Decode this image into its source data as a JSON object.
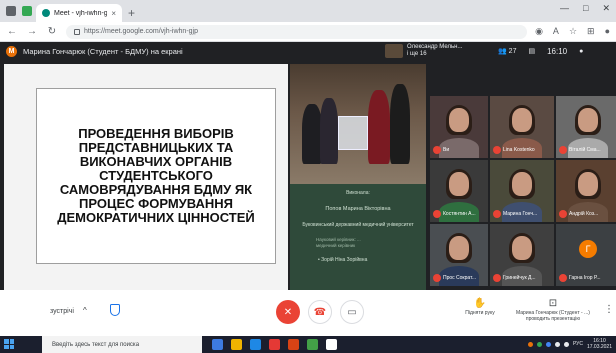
{
  "browser": {
    "tab_title": "Meet - vjh-iwhn-gjp",
    "tab_close": "×",
    "new_tab": "+",
    "url": "https://meet.google.com/vjh-iwhn-gjp",
    "window_controls": [
      "—",
      "□",
      "✕"
    ]
  },
  "meet_header": {
    "presenter_initial": "M",
    "presenting_text": "Марина Гончарюк (Студент - БДМУ) на екрані",
    "pinned_name": "Олександр Мельн...",
    "pinned_sub": "і ще 16",
    "participants_count": "27",
    "time": "16:10"
  },
  "slide": {
    "title": "Проведення виборів представницьких та виконавчих органів студентського самоврядування БДМУ як процес формування демократичних цінностей"
  },
  "caption": {
    "line1": "Виконала:",
    "line2": "Попов Марина Вікторівна",
    "line3": "Буковинський державний медичний університет",
    "line4a": "Науковий керівник: ...",
    "line4b": "медичний керівник",
    "line5": "• Зорій Ніна Зорійвна"
  },
  "tiles": [
    {
      "name": "Ви",
      "color": "#4a3a3a",
      "body": "#7a6a6a"
    },
    {
      "name": "Lina Kostenko",
      "color": "#5a4a42",
      "body": "#8a5a4a"
    },
    {
      "name": "Віталій Сма...",
      "color": "#6a6a6a",
      "body": "#aaaaaa"
    },
    {
      "name": "Костянтин А...",
      "color": "#3a3a3a",
      "body": "#2f6f3f"
    },
    {
      "name": "Марина Гонч...",
      "color": "#4a4a3a",
      "body": "#3f4f6f"
    },
    {
      "name": "Андрій Коз...",
      "color": "#5a4030",
      "body": "#6a5040"
    },
    {
      "name": "Прос Сократ...",
      "color": "#4a4e52",
      "body": "#2a3a5a"
    },
    {
      "name": "Гринейчук Д...",
      "color": "#3f3f3f",
      "body": "#555555"
    },
    {
      "name": "Гарна Ігор Р...",
      "initial": "Г"
    }
  ],
  "controls": {
    "left_text": "зустрічі",
    "left_arrow": "^",
    "raise_hand": "Підняти руку",
    "present": "Марина Гончарюк (Студент - ...) проводить презентацію",
    "more": "⋮"
  },
  "taskbar": {
    "search_placeholder": "Введіть здесь текст для поиска",
    "time": "16:10",
    "date": "17.03.2021",
    "lang": "РУС"
  },
  "colors": {
    "meet_dark": "#202124",
    "end_call_red": "#ea4335",
    "caption_green": "#2f4a3a",
    "taskbar": "#1b1f2e"
  }
}
